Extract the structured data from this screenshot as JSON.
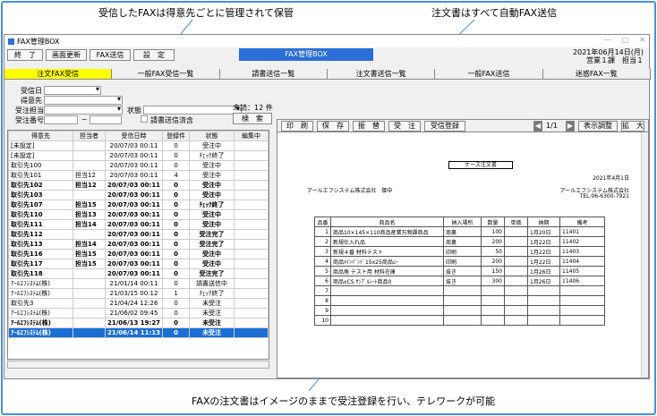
{
  "annotations": {
    "top_left": "受信したFAXは得意先ごとに管理されて保管",
    "top_right": "注文書はすべて自動FAX送信",
    "bottom": "FAXの注文書はイメージのままで受注登録を行い、テレワークが可能"
  },
  "window": {
    "title": "FAX管理BOX",
    "controls": [
      "―",
      "□",
      "✕"
    ]
  },
  "toolbar": {
    "exit_label": "終　了",
    "refresh_label": "画面更新",
    "fax_send_label": "FAX送信",
    "settings_label": "設　定",
    "app_title": "FAX管理BOX",
    "date": "2021年06月14日(月)",
    "user": "営業１課　担当１"
  },
  "tabs": [
    "注文FAX受信",
    "一般FAX受信一覧",
    "請書送信一覧",
    "注文書送信一覧",
    "一般FAX送信",
    "迷惑FAX一覧"
  ],
  "filters": {
    "received_date": "受信日",
    "customer": "得意先",
    "order_owner": "受注担当",
    "status": "状態",
    "order_no": "受注番号",
    "tilde": "~",
    "checkbox_label": "請書送信済含",
    "unread_label": "未読：12 件",
    "search_label": "検　索"
  },
  "list": {
    "headers": [
      "得意先",
      "担当者",
      "受信日時",
      "登録件",
      "状態",
      "編集中"
    ],
    "rows": [
      {
        "c": "[未設定]",
        "p": "",
        "d": "20/07/03 00:11",
        "n": "0",
        "s": "受注中",
        "bold": false
      },
      {
        "c": "[未設定]",
        "p": "",
        "d": "20/07/03 00:11",
        "n": "0",
        "s": "ﾁｪｯｸ終了",
        "bold": false
      },
      {
        "c": "取引先100",
        "p": "",
        "d": "20/07/03 00:11",
        "n": "0",
        "s": "受注中",
        "bold": false
      },
      {
        "c": "取引先101",
        "p": "担当12",
        "d": "20/07/03 00:11",
        "n": "4",
        "s": "受注中",
        "bold": false
      },
      {
        "c": "取引先102",
        "p": "担当12",
        "d": "20/07/03 00:11",
        "n": "0",
        "s": "受注中",
        "bold": true
      },
      {
        "c": "取引先103",
        "p": "",
        "d": "20/07/03 00:11",
        "n": "0",
        "s": "受注中",
        "bold": true
      },
      {
        "c": "取引先107",
        "p": "担当15",
        "d": "20/07/03 00:11",
        "n": "0",
        "s": "ﾁｪｯｸ終了",
        "bold": true
      },
      {
        "c": "取引先110",
        "p": "担当13",
        "d": "20/07/03 00:11",
        "n": "0",
        "s": "受注中",
        "bold": true
      },
      {
        "c": "取引先111",
        "p": "担当14",
        "d": "20/07/03 00:11",
        "n": "0",
        "s": "受注中",
        "bold": true
      },
      {
        "c": "取引先112",
        "p": "",
        "d": "20/07/03 00:11",
        "n": "0",
        "s": "受注完了",
        "bold": true
      },
      {
        "c": "取引先113",
        "p": "担当14",
        "d": "20/07/03 00:11",
        "n": "0",
        "s": "受注完了",
        "bold": true
      },
      {
        "c": "取引先116",
        "p": "担当15",
        "d": "20/07/03 00:11",
        "n": "0",
        "s": "受注中",
        "bold": true
      },
      {
        "c": "取引先117",
        "p": "担当15",
        "d": "20/07/03 00:11",
        "n": "0",
        "s": "受注中",
        "bold": true
      },
      {
        "c": "取引先118",
        "p": "",
        "d": "20/07/03 00:11",
        "n": "0",
        "s": "受注完了",
        "bold": true
      },
      {
        "c": "ｱｰﾙｴﾌｼｽﾃﾑ(株)",
        "p": "",
        "d": "21/01/14 00:11",
        "n": "0",
        "s": "請書送信中",
        "bold": false
      },
      {
        "c": "ｱｰﾙｴﾌｼｽﾃﾑ(株)",
        "p": "",
        "d": "21/03/15 00:12",
        "n": "1",
        "s": "ﾁｪｯｸ終了",
        "bold": false
      },
      {
        "c": "取引先3",
        "p": "",
        "d": "21/04/24 12:26",
        "n": "0",
        "s": "未受注",
        "bold": false
      },
      {
        "c": "ｱｰﾙｴﾌｼｽﾃﾑ(株)",
        "p": "",
        "d": "21/06/02 09:45",
        "n": "0",
        "s": "未受注",
        "bold": false
      },
      {
        "c": "ｱｰﾙｴﾌｼｽﾃﾑ(株)",
        "p": "",
        "d": "21/06/13 19:27",
        "n": "0",
        "s": "未受注",
        "bold": true
      },
      {
        "c": "ｱｰﾙｴﾌｼｽﾃﾑ(株)",
        "p": "",
        "d": "21/06/14 11:13",
        "n": "0",
        "s": "未受注",
        "bold": true,
        "selected": true
      }
    ]
  },
  "viewer": {
    "print": "印　刷",
    "save": "保　存",
    "transfer": "振　替",
    "order": "受　注",
    "register": "受信登録",
    "page": "1/1",
    "display": "表示調整",
    "zoom": "拡　大"
  },
  "doc": {
    "title": "ケース注文書",
    "date": "2021年4月1日",
    "to": "アールエフシステム株式会社　御中",
    "from": "アールエフシステム株式会社",
    "tel": "TEL:06-6300-7921",
    "headers": [
      "品番",
      "商品名",
      "納入場所",
      "数量",
      "単価",
      "納期",
      "備考"
    ],
    "rows": [
      [
        "1",
        "商品10×145×110商品産業万物課商品",
        "商裏",
        "100",
        "",
        "1月20日",
        "11401"
      ],
      [
        "2",
        "新規仕入れ品",
        "商裏",
        "200",
        "",
        "1月22日",
        "11402"
      ],
      [
        "3",
        "新規４番 材料テスト",
        "印刷",
        "50",
        "",
        "1月22日",
        "11403"
      ],
      [
        "4",
        "商品ﾒｲﾝﾊﾞﾝﾄﾞ15x25商品ﾑｰ",
        "印刷",
        "200",
        "",
        "1月22日",
        "11404"
      ],
      [
        "5",
        "商品角 テスト用 材料在庫",
        "抜き",
        "150",
        "",
        "1月26日",
        "11405"
      ],
      [
        "6",
        "商品xCS ｻﾝﾌﾟﾙｼｰﾄ商品0",
        "抜き",
        "300",
        "",
        "1月26日",
        "11406"
      ],
      [
        "7",
        "",
        "",
        "",
        "",
        "",
        ""
      ],
      [
        "8",
        "",
        "",
        "",
        "",
        "",
        ""
      ],
      [
        "9",
        "",
        "",
        "",
        "",
        "",
        ""
      ],
      [
        "10",
        "",
        "",
        "",
        "",
        "",
        ""
      ]
    ]
  },
  "colors": {
    "accent": "#2b6fd6",
    "active_tab": "#ffff00",
    "selected_row": "#1a6fd6",
    "frame": "#4a90d9"
  }
}
